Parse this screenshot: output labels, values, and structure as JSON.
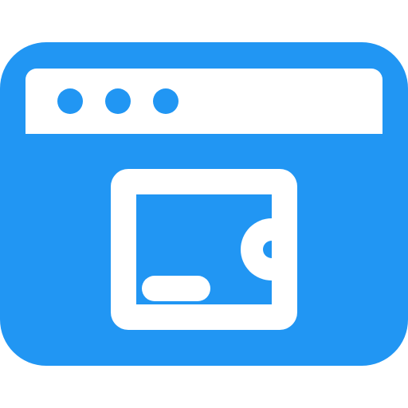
{
  "icon": {
    "name": "browser-wallet-icon",
    "colors": {
      "primary": "#2196F3",
      "foreground": "#FFFFFF",
      "background": "#FFFFFF"
    },
    "parts": {
      "window": "browser-window-icon",
      "dots": [
        "window-dot-icon",
        "window-dot-icon",
        "window-dot-icon"
      ],
      "address_bar": "address-bar-icon",
      "wallet": "wallet-icon",
      "wallet_clasp": "wallet-clasp-icon",
      "wallet_slot": "wallet-slot-icon"
    }
  }
}
